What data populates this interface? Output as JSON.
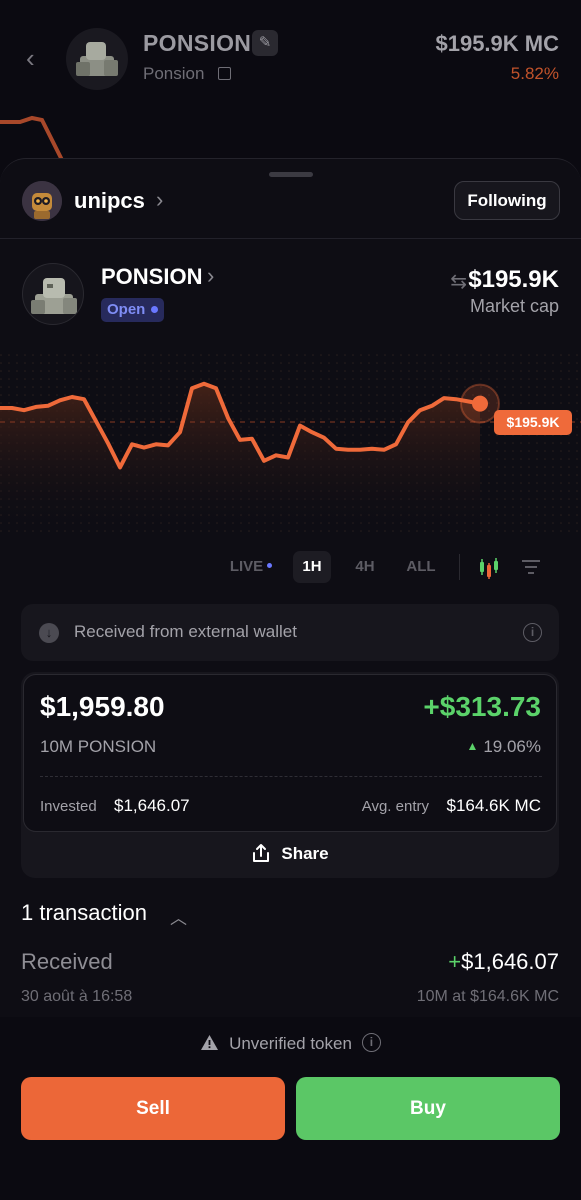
{
  "background_header": {
    "title": "PONSION",
    "subtitle": "Ponsion",
    "market_cap": "$195.9K MC",
    "change_pct": "5.82%"
  },
  "creator": {
    "name": "unipcs",
    "follow_label": "Following"
  },
  "token": {
    "name": "PONSION",
    "status_badge": "Open",
    "market_cap_value": "$195.9K",
    "market_cap_label": "Market cap"
  },
  "chart": {
    "current_price_label": "$195.9K",
    "line_color": "#ef6a3a",
    "series": [
      0.6,
      0.6,
      0.58,
      0.61,
      0.62,
      0.67,
      0.7,
      0.68,
      0.48,
      0.28,
      0.06,
      0.27,
      0.24,
      0.27,
      0.26,
      0.38,
      0.78,
      0.82,
      0.78,
      0.51,
      0.31,
      0.32,
      0.12,
      0.17,
      0.15,
      0.44,
      0.38,
      0.33,
      0.23,
      0.22,
      0.22,
      0.23,
      0.22,
      0.27,
      0.47,
      0.58,
      0.62,
      0.69,
      0.68,
      0.66,
      0.64
    ]
  },
  "ranges": {
    "live": "LIVE",
    "h1": "1H",
    "h4": "4H",
    "all": "ALL"
  },
  "notice": {
    "text": "Received from external wallet"
  },
  "holding": {
    "value": "$1,959.80",
    "pnl": "+$313.73",
    "quantity": "10M PONSION",
    "pnl_pct": "19.06%",
    "invested_label": "Invested",
    "invested_value": "$1,646.07",
    "avg_entry_label": "Avg. entry",
    "avg_entry_value": "$164.6K MC",
    "share_label": "Share"
  },
  "transactions": {
    "header": "1 transaction",
    "items": [
      {
        "type": "Received",
        "amount_sign": "+",
        "amount": "$1,646.07",
        "date": "30 août à 16:58",
        "detail": "10M at $164.6K MC"
      }
    ]
  },
  "footer": {
    "warning": "Unverified token",
    "sell_label": "Sell",
    "buy_label": "Buy"
  },
  "colors": {
    "accent_orange": "#ec6738",
    "accent_green": "#5bc766",
    "badge_blue": "#7f8df5"
  }
}
